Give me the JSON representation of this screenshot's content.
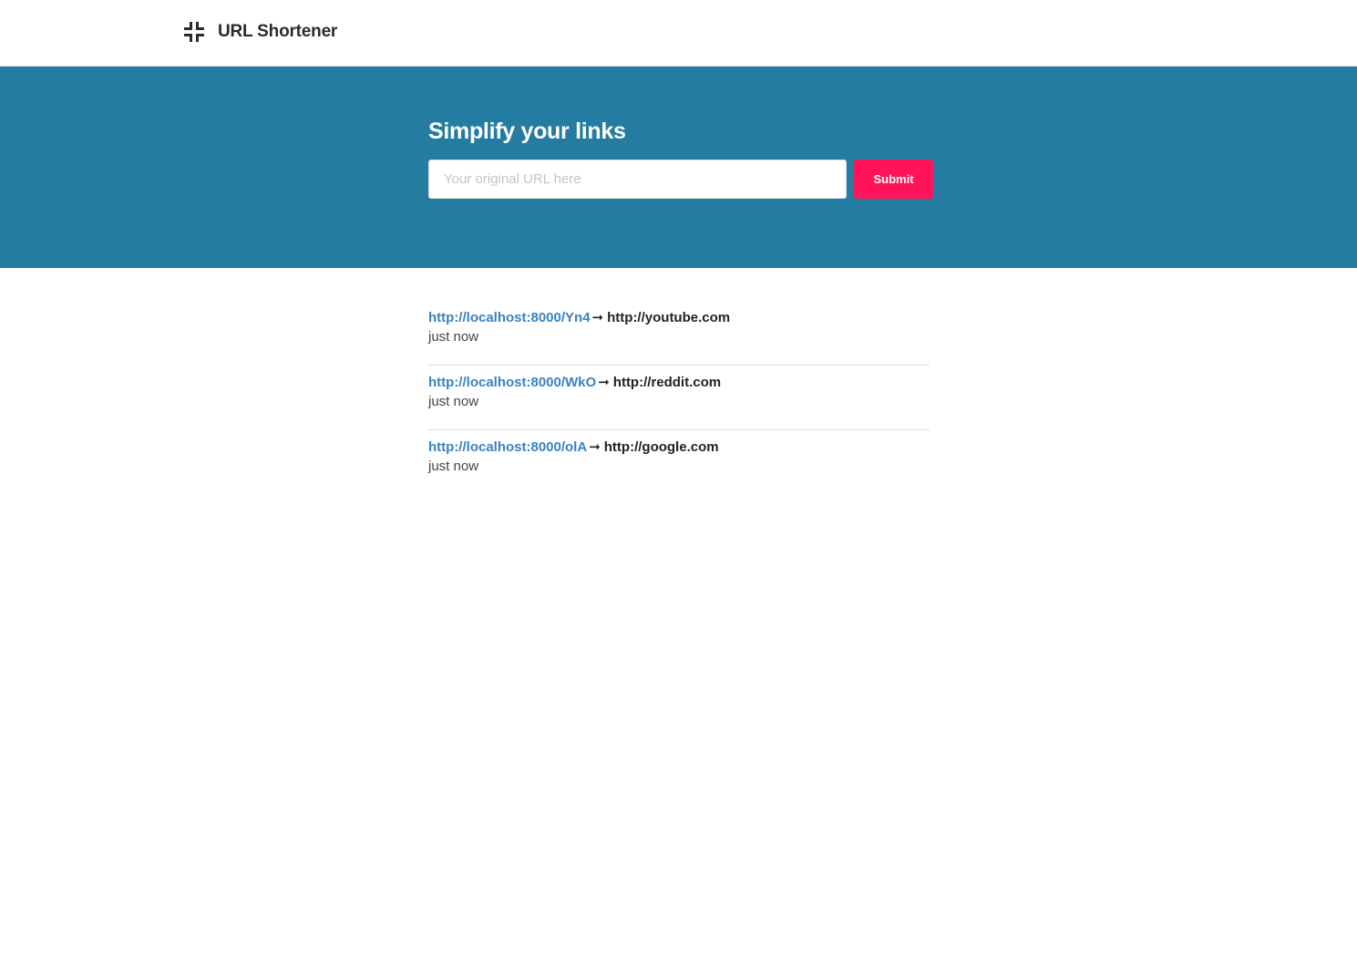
{
  "header": {
    "icon": "compress-icon",
    "title": "URL Shortener"
  },
  "hero": {
    "title": "Simplify your links",
    "input_placeholder": "Your original URL here",
    "input_value": "",
    "submit_label": "Submit"
  },
  "links": [
    {
      "short_url": "http://localhost:8000/Yn4",
      "arrow": "➞",
      "original_url": "http://youtube.com",
      "time": "just now"
    },
    {
      "short_url": "http://localhost:8000/WkO",
      "arrow": "➞",
      "original_url": "http://reddit.com",
      "time": "just now"
    },
    {
      "short_url": "http://localhost:8000/olA",
      "arrow": "➞",
      "original_url": "http://google.com",
      "time": "just now"
    }
  ],
  "colors": {
    "hero_bg": "#247ca0",
    "accent_button": "#ff1459",
    "link": "#3a82c4"
  }
}
